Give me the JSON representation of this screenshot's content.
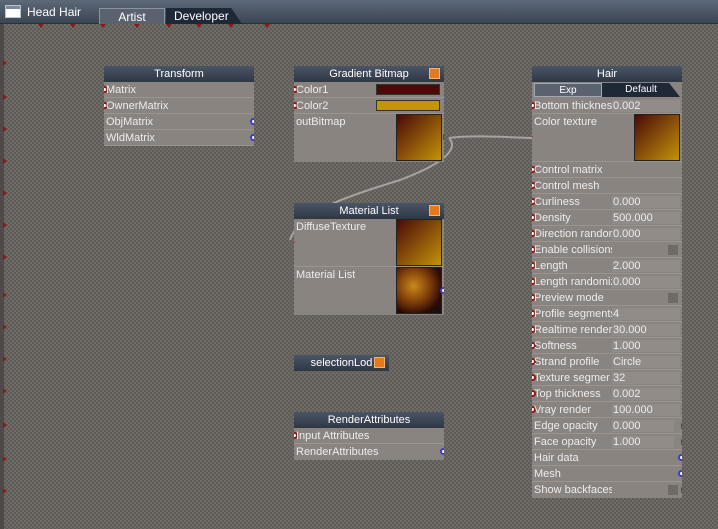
{
  "window": {
    "title": "Head Hair",
    "tabs": [
      "Artist",
      "Developer"
    ]
  },
  "nodes": {
    "transform": {
      "title": "Transform",
      "rows": [
        "Matrix",
        "OwnerMatrix",
        "ObjMatrix",
        "WldMatrix"
      ]
    },
    "gradient": {
      "title": "Gradient Bitmap",
      "color1_label": "Color1",
      "color2_label": "Color2",
      "out_label": "outBitmap",
      "color1": "#4a0a08",
      "color2": "#c29408"
    },
    "material_list": {
      "title": "Material List",
      "diffuse_label": "DiffuseTexture",
      "list_label": "Material List"
    },
    "selection": {
      "title": "selectionLod"
    },
    "render_attributes": {
      "title": "RenderAttributes",
      "rows": [
        "Input Attributes",
        "RenderAttributes"
      ]
    },
    "hair": {
      "title": "Hair",
      "tab_exp": "Exp",
      "tab_default": "Default",
      "rows": [
        {
          "label": "Bottom thicknes",
          "value": "0.002"
        },
        {
          "label": "Color texture",
          "value": ""
        },
        {
          "label": "Control matrix",
          "value": ""
        },
        {
          "label": "Control mesh",
          "value": ""
        },
        {
          "label": "Curliness",
          "value": "0.000"
        },
        {
          "label": "Density",
          "value": "500.000"
        },
        {
          "label": "Direction randor",
          "value": "0.000"
        },
        {
          "label": "Enable collisions",
          "value": ""
        },
        {
          "label": "Length",
          "value": "2.000"
        },
        {
          "label": "Length randomiz",
          "value": "0.000"
        },
        {
          "label": "Preview mode",
          "value": ""
        },
        {
          "label": "Profile segments",
          "value": "4"
        },
        {
          "label": "Realtime render",
          "value": "30.000"
        },
        {
          "label": "Softness",
          "value": "1.000"
        },
        {
          "label": "Strand profile",
          "value": "Circle"
        },
        {
          "label": "Texture segmer",
          "value": "32"
        },
        {
          "label": "Top thickness",
          "value": "0.002"
        },
        {
          "label": "Vray render",
          "value": "100.000"
        },
        {
          "label": "Edge opacity",
          "value": "0.000"
        },
        {
          "label": "Face opacity",
          "value": "1.000"
        },
        {
          "label": "Hair data",
          "value": ""
        },
        {
          "label": "Mesh",
          "value": ""
        },
        {
          "label": "Show backfaces",
          "value": ""
        }
      ]
    }
  },
  "colors": {
    "canvas": "#6f6b67",
    "node_body": "#8a8480",
    "header": "#2e3744",
    "accent": "#e07b1f",
    "input_pin": "#8a1a1a",
    "output_pin": "#3a3ad0"
  }
}
